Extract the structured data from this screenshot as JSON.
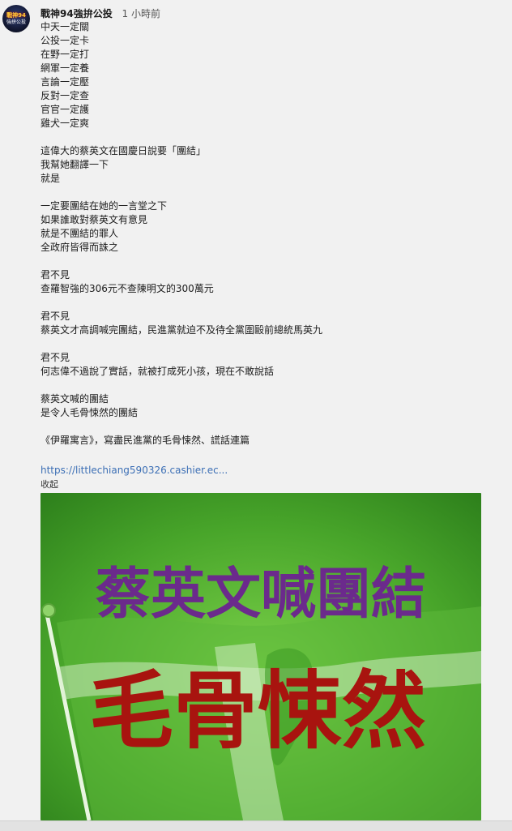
{
  "post": {
    "author": "戰神94強拚公投",
    "time": "1 小時前",
    "lines": [
      "中天一定關",
      "公投一定卡",
      "在野一定打",
      "網軍一定養",
      "言論一定壓",
      "反對一定查",
      "官官一定護",
      "雞犬一定爽",
      "",
      "這偉大的蔡英文在國慶日說要「團結」",
      "我幫她翻譯一下",
      "就是",
      "",
      "一定要團結在她的一言堂之下",
      "如果誰敢對蔡英文有意見",
      "就是不團結的罪人",
      "全政府皆得而誅之",
      "",
      "君不見",
      "查羅智強的306元不查陳明文的300萬元",
      "",
      "君不見",
      "蔡英文才高調喊完團結，民進黨就迫不及待全黨圍毆前總統馬英九",
      "",
      "君不見",
      "何志偉不過說了實話，就被打成死小孩，現在不敢說話",
      "",
      "蔡英文喊的團結",
      "是令人毛骨悚然的團結",
      "",
      "《伊羅寓言》，寫盡民進黨的毛骨悚然、謊話連篇"
    ],
    "link_text": "https://littlechiang590326.cashier.ec...",
    "collapse_label": "收起",
    "image": {
      "headline": "蔡英文喊團結",
      "subheadline": "毛骨悚然"
    }
  },
  "avatar": {
    "top_text": "戰神94",
    "bottom_text": "強拚公投"
  },
  "colors": {
    "background": "#f1f1f1",
    "link": "#3c6fb5",
    "headline": "#6b2a8c",
    "subheadline": "#a8140f",
    "image_green": "#4ba82c"
  }
}
